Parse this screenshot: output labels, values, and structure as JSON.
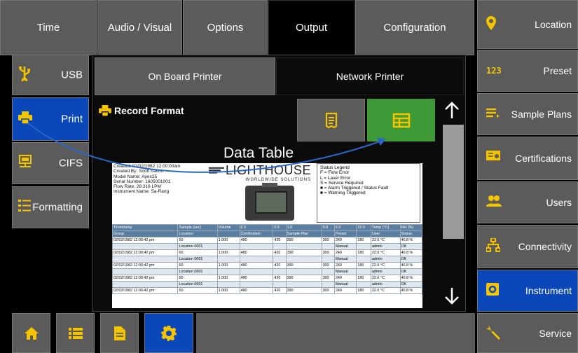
{
  "top_tabs": [
    "Time",
    "Audio / Visual",
    "Options",
    "Output",
    "Configuration"
  ],
  "left_menu": [
    "USB",
    "Print",
    "CIFS",
    "Formatting"
  ],
  "printer_tabs": {
    "onboard": "On Board Printer",
    "network": "Network Printer"
  },
  "record_format_label": "Record Format",
  "preview": {
    "title": "Data Table",
    "meta": [
      "Created: 02/02/1982 12:00:00am",
      "Created By: Scott Salton",
      "Model Name: Apex25",
      "Serial Number: 1605001001",
      "Flow Rate: 28.316 LPM",
      "Instrument Name: Sa-Rang"
    ],
    "logo_text": "LIGHTHOUSE",
    "logo_sub": "WORLDWIDE SOLUTIONS",
    "legend": [
      "Status Legend",
      "F = Flow Error",
      "L = Laser Error",
      "S = Service Required",
      "■ = Alarm Triggered / Status Fault",
      "■ = Warning Triggered"
    ],
    "table": {
      "header1": [
        "Timestamp",
        "Sample (sec)",
        "Volume",
        "0.3",
        "0.5",
        "1.0",
        "5.0",
        "5.0",
        "10.0",
        "Temp (°C)",
        "RH (%)"
      ],
      "header2": [
        "Group",
        "Location",
        "",
        "Certification",
        "",
        "Sample Plan",
        "",
        "Preset",
        "",
        "User",
        "Status"
      ],
      "rows": [
        [
          "02/02/1982 12:00:42 pm",
          "60",
          "1.000",
          "480",
          "420",
          "390",
          "300",
          "240",
          "180",
          "22.6 °C",
          "40.8 %"
        ],
        [
          "",
          "Location 0001",
          "",
          "",
          "",
          "",
          "",
          "Manual",
          "",
          "admin",
          "OK"
        ],
        [
          "02/02/1982 12:00:42 pm",
          "60",
          "1.000",
          "480",
          "420",
          "390",
          "300",
          "240",
          "180",
          "22.6 °C",
          "40.8 %"
        ],
        [
          "",
          "Location 0001",
          "",
          "",
          "",
          "",
          "",
          "Manual",
          "",
          "admin",
          "OK"
        ],
        [
          "02/02/1982 12:00:42 pm",
          "60",
          "1.000",
          "480",
          "420",
          "390",
          "300",
          "240",
          "180",
          "22.6 °C",
          "40.8 %"
        ],
        [
          "",
          "Location 0001",
          "",
          "",
          "",
          "",
          "",
          "Manual",
          "",
          "admin",
          "OK"
        ],
        [
          "02/02/1982 12:00:42 pm",
          "60",
          "1.000",
          "480",
          "420",
          "390",
          "300",
          "240",
          "180",
          "22.6 °C",
          "40.8 %"
        ],
        [
          "",
          "Location 0001",
          "",
          "",
          "",
          "",
          "",
          "Manual",
          "",
          "admin",
          "OK"
        ],
        [
          "02/02/1982 12:00:42 pm",
          "60",
          "1.000",
          "480",
          "420",
          "390",
          "300",
          "240",
          "180",
          "22.6 °C",
          "40.8 %"
        ]
      ]
    }
  },
  "right_menu": [
    "Location",
    "Preset",
    "Sample Plans",
    "Certifications",
    "Users",
    "Connectivity",
    "Instrument",
    "Service"
  ],
  "right_menu_icons": {
    "preset": "123"
  },
  "bottom_nav": [
    "home-icon",
    "list-icon",
    "document-icon",
    "gear-icon"
  ],
  "colors": {
    "accent_blue": "#0a47b8",
    "accent_green": "#3d9a36",
    "icon_yellow": "#f5c400",
    "button_gray": "#5b5b5b"
  }
}
